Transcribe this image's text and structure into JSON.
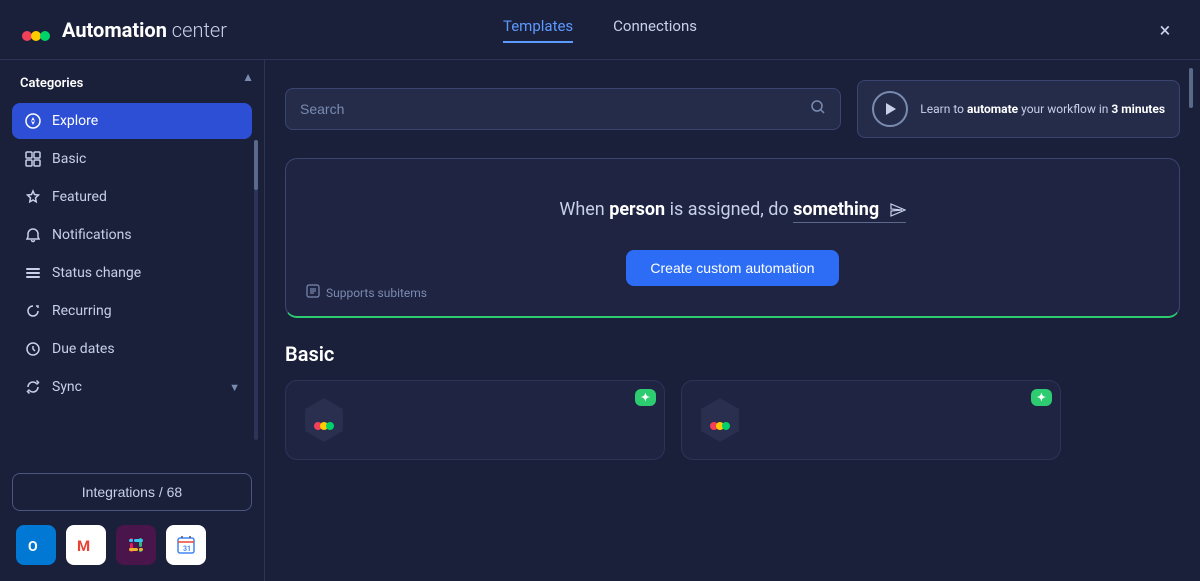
{
  "header": {
    "logo_alt": "monday.com logo",
    "title_bold": "Automation",
    "title_light": " center",
    "tabs": [
      {
        "label": "Templates",
        "active": true
      },
      {
        "label": "Connections",
        "active": false
      }
    ],
    "close_label": "×"
  },
  "sidebar": {
    "categories_title": "Categories",
    "items": [
      {
        "id": "explore",
        "label": "Explore",
        "icon": "🧭",
        "active": true
      },
      {
        "id": "basic",
        "label": "Basic",
        "icon": "⊞",
        "active": false
      },
      {
        "id": "featured",
        "label": "Featured",
        "icon": "💎",
        "active": false
      },
      {
        "id": "notifications",
        "label": "Notifications",
        "icon": "🔔",
        "active": false
      },
      {
        "id": "status-change",
        "label": "Status change",
        "icon": "☰",
        "active": false
      },
      {
        "id": "recurring",
        "label": "Recurring",
        "icon": "↻",
        "active": false
      },
      {
        "id": "due-dates",
        "label": "Due dates",
        "icon": "⊙",
        "active": false
      },
      {
        "id": "sync",
        "label": "Sync",
        "icon": "⟳",
        "active": false,
        "has_chevron": true
      }
    ],
    "integrations_button": "Integrations / 68",
    "integration_apps": [
      {
        "name": "outlook",
        "color": "#0078d4",
        "label": "O"
      },
      {
        "name": "gmail",
        "color": "#ffffff",
        "label": "M"
      },
      {
        "name": "slack",
        "color": "#4a154b",
        "label": "S"
      },
      {
        "name": "gcal",
        "color": "#ffffff",
        "label": "C"
      }
    ]
  },
  "search": {
    "placeholder": "Search"
  },
  "video_banner": {
    "text_before": "Learn to ",
    "text_bold": "automate",
    "text_after": " your workflow in ",
    "time_bold": "3 minutes"
  },
  "custom_automation": {
    "sentence_before": "When ",
    "trigger_bold": "person",
    "sentence_middle": " is assigned, do ",
    "action_bold": "something",
    "supports_subitems": "Supports subitems",
    "create_button": "Create custom automation"
  },
  "basic_section": {
    "title": "Basic",
    "cards": [
      {
        "id": "card1",
        "has_ai": true,
        "ai_label": "✦"
      },
      {
        "id": "card2",
        "has_ai": true,
        "ai_label": "✦"
      }
    ]
  }
}
